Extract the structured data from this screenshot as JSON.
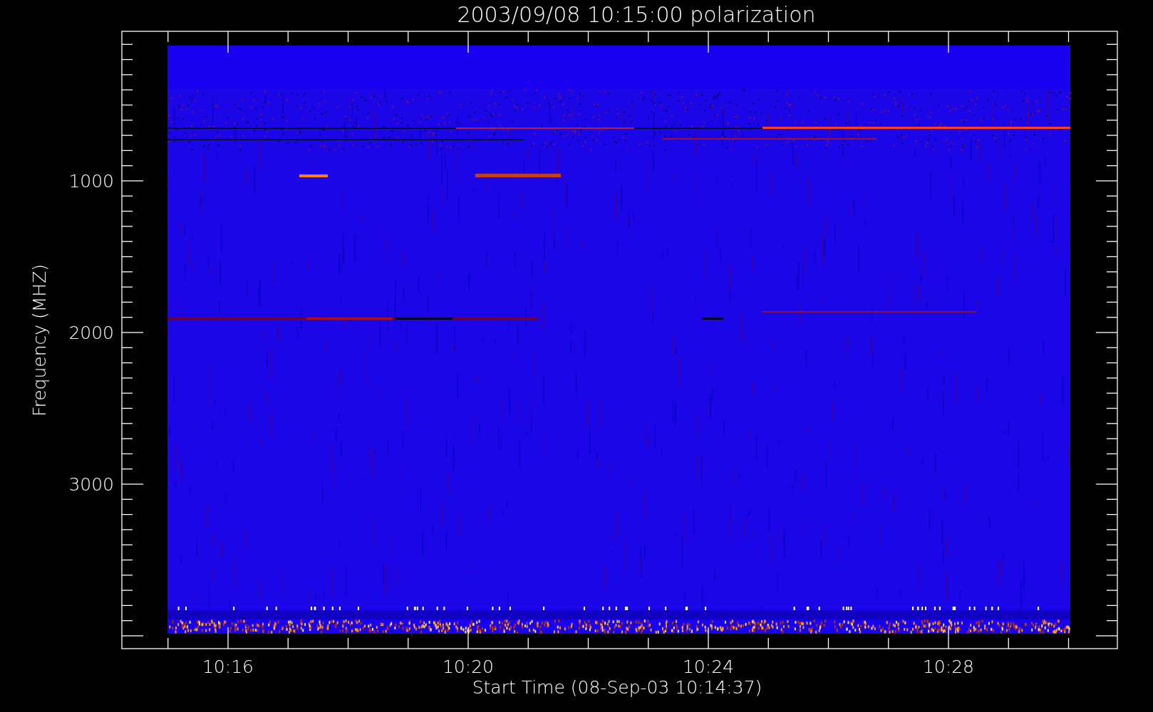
{
  "title": "2003/09/08 10:15:00 polarization",
  "plot": {
    "ylabel": "Frequency (MHZ)",
    "xlabel": "Start Time (08-Sep-03 10:14:37)",
    "yticks": [
      "1000",
      "2000",
      "3000"
    ],
    "xticks": [
      "10:16",
      "10:20",
      "10:24",
      "10:28"
    ]
  }
}
